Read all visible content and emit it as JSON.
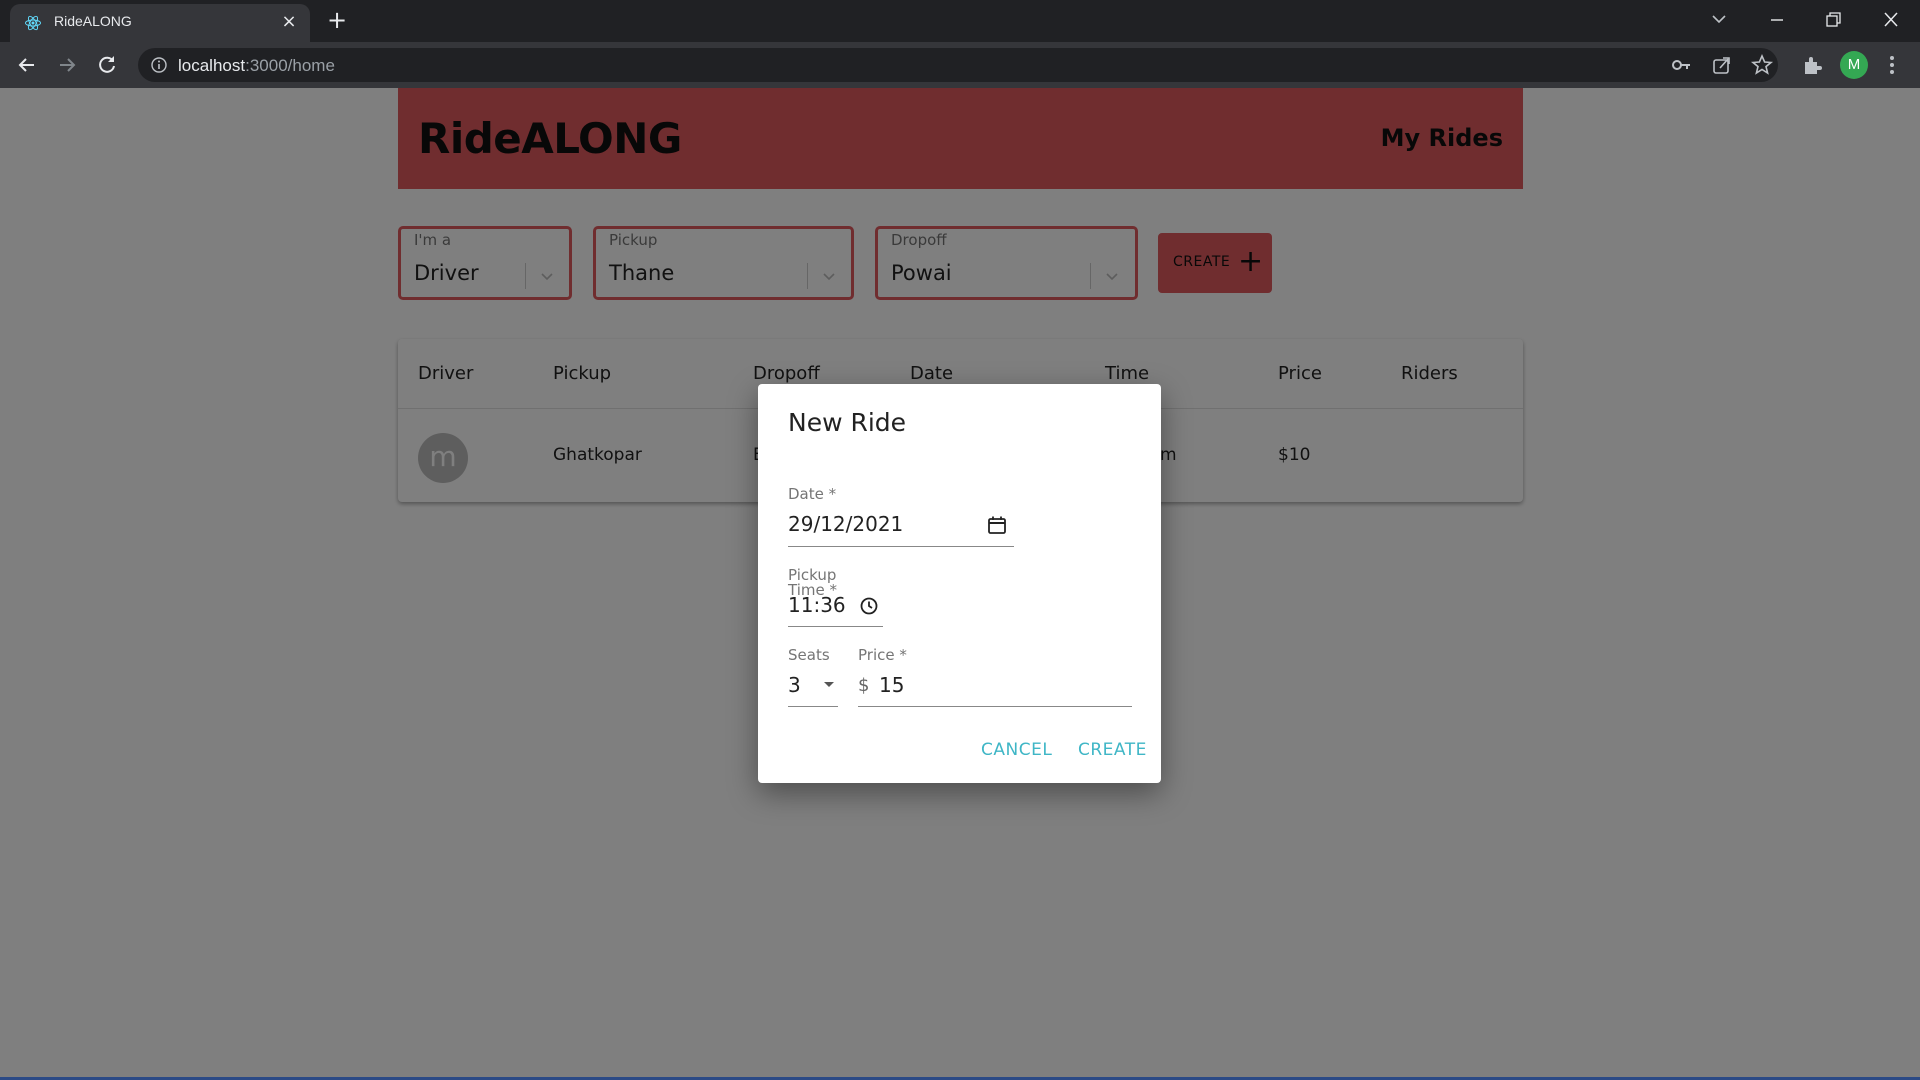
{
  "browser": {
    "tab_title": "RideALONG",
    "tab_close_glyph": "×",
    "new_tab_glyph": "+",
    "url_host": "localhost",
    "url_rest": ":3000/home",
    "profile_initial": "M"
  },
  "header": {
    "brand": "RideALONG",
    "my_rides": "My Rides",
    "color": "#e05a5e"
  },
  "filters": {
    "role": {
      "label": "I'm a",
      "value": "Driver"
    },
    "pickup": {
      "label": "Pickup",
      "value": "Thane"
    },
    "dropoff": {
      "label": "Dropoff",
      "value": "Powai"
    },
    "create_label": "CREATE",
    "create_plus": "+"
  },
  "table": {
    "columns": [
      "Driver",
      "Pickup",
      "Dropoff",
      "Date",
      "Time",
      "Price",
      "Riders"
    ],
    "rows": [
      {
        "avatar": "m",
        "pickup": "Ghatkopar",
        "dropoff": "E",
        "time": "m",
        "price": "$10"
      }
    ]
  },
  "dialog": {
    "title": "New Ride",
    "date_label": "Date *",
    "date_value": "29/12/2021",
    "pickup_time_label_1": "Pickup",
    "pickup_time_label_2": "Time *",
    "time_value": "11:36",
    "seats_label": "Seats",
    "seats_value": "3",
    "price_label": "Price *",
    "price_prefix": "$",
    "price_value": "15",
    "cancel": "CANCEL",
    "create": "CREATE",
    "accent": "#3fb6c6"
  }
}
